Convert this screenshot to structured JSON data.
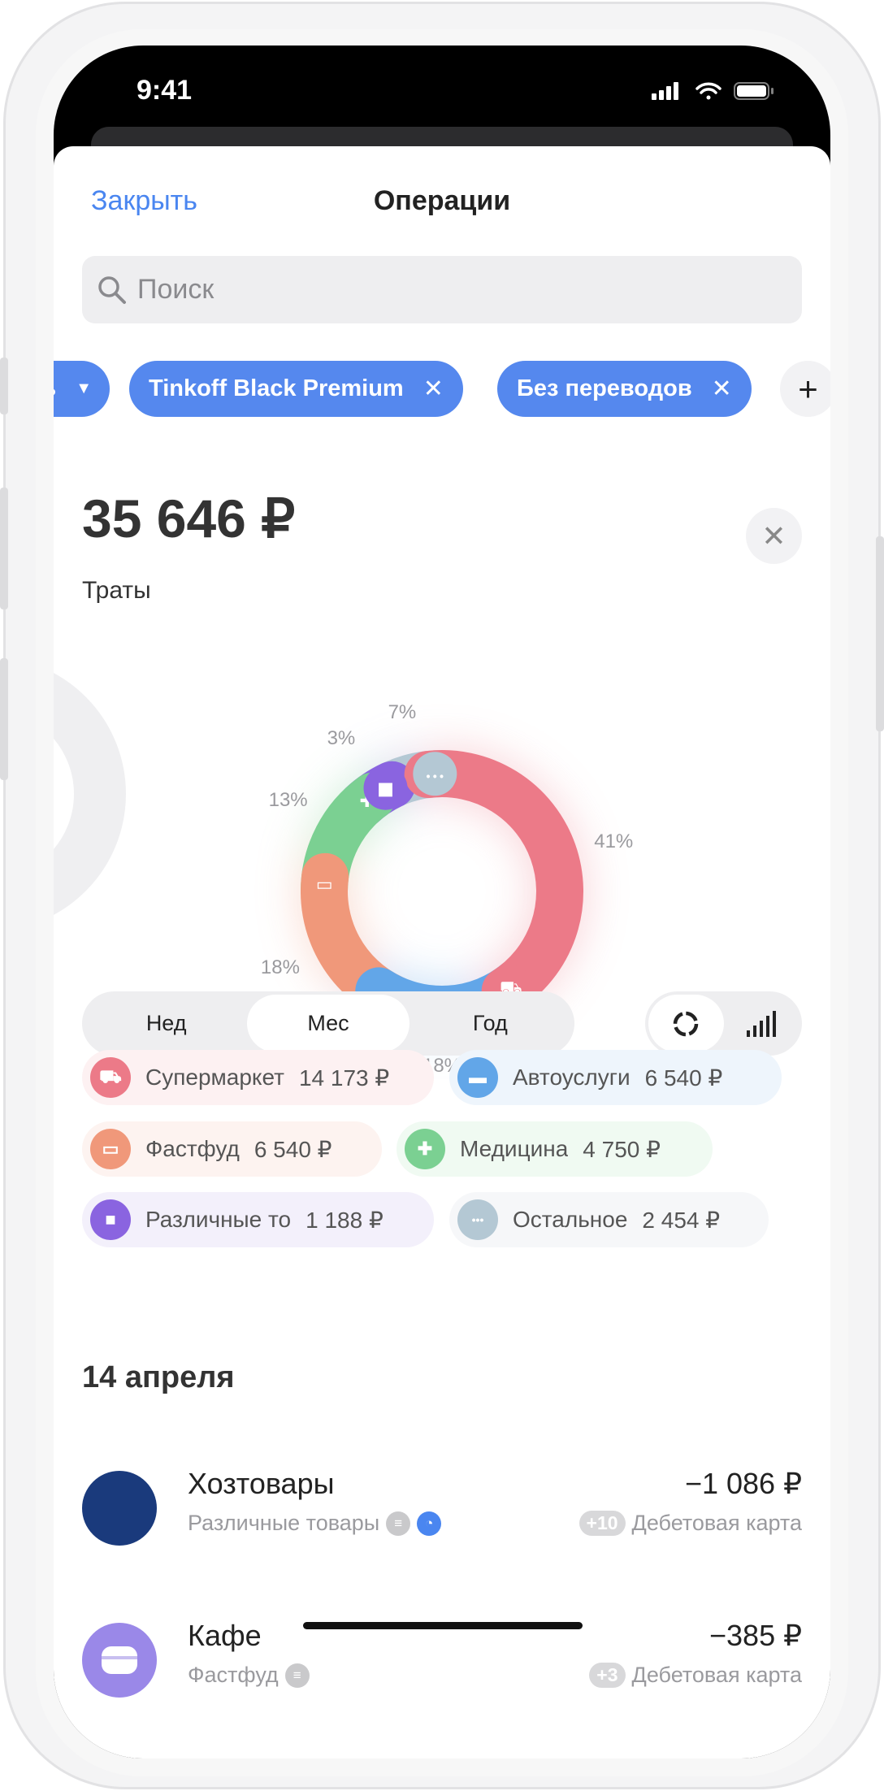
{
  "status": {
    "time": "9:41"
  },
  "header": {
    "close": "Закрыть",
    "title": "Операции"
  },
  "search": {
    "placeholder": "Поиск"
  },
  "filters": [
    {
      "label": "ь",
      "type": "dropdown"
    },
    {
      "label": "Tinkoff Black Premium"
    },
    {
      "label": "Без переводов"
    }
  ],
  "summary": {
    "amount": "35 646 ₽",
    "label": "Траты"
  },
  "chart_data": {
    "type": "pie",
    "style": "donut",
    "categories": [
      "Супермаркет",
      "Автоуслуги",
      "Фастфуд",
      "Медицина",
      "Различные товары",
      "Остальное"
    ],
    "values": [
      41,
      18,
      18,
      13,
      3,
      7
    ],
    "labels": [
      "41%",
      "18%",
      "18%",
      "13%",
      "3%",
      "7%"
    ],
    "colors": [
      "#ec7a88",
      "#62a6e8",
      "#f0987a",
      "#7bd092",
      "#8a64e0",
      "#b4c8d4"
    ],
    "icons": [
      "cart-icon",
      "car-icon",
      "burger-icon",
      "cross-icon",
      "box-icon",
      "dots-icon"
    ]
  },
  "periods": [
    {
      "label": "Нед"
    },
    {
      "label": "Мес",
      "selected": true
    },
    {
      "label": "Год"
    }
  ],
  "categories": [
    {
      "name": "Супермаркет",
      "amount": "14 173 ₽",
      "color": "#ec7a88",
      "bg": "#fdf1f2"
    },
    {
      "name": "Автоуслуги",
      "amount": "6 540 ₽",
      "color": "#62a6e8",
      "bg": "#eef5fc"
    },
    {
      "name": "Фастфуд",
      "amount": "6 540 ₽",
      "color": "#f0987a",
      "bg": "#fdf3f0"
    },
    {
      "name": "Медицина",
      "amount": "4 750 ₽",
      "color": "#7bd092",
      "bg": "#f0faf2"
    },
    {
      "name": "Различные то",
      "amount": "1 188 ₽",
      "color": "#8a64e0",
      "bg": "#f3f0fb"
    },
    {
      "name": "Остальное",
      "amount": "2 454 ₽",
      "color": "#b4c8d4",
      "bg": "#f6f7f9"
    }
  ],
  "date": "14 апреля",
  "transactions": [
    {
      "title": "Хозтовары",
      "category": "Различные товары",
      "amount": "−1 086 ₽",
      "badge": "+10",
      "card": "Дебетовая карта",
      "avatar_color": "#1a3a7c"
    },
    {
      "title": "Кафе",
      "category": "Фастфуд",
      "amount": "−385 ₽",
      "badge": "+3",
      "card": "Дебетовая карта",
      "avatar_color": "#9a88e8"
    }
  ]
}
